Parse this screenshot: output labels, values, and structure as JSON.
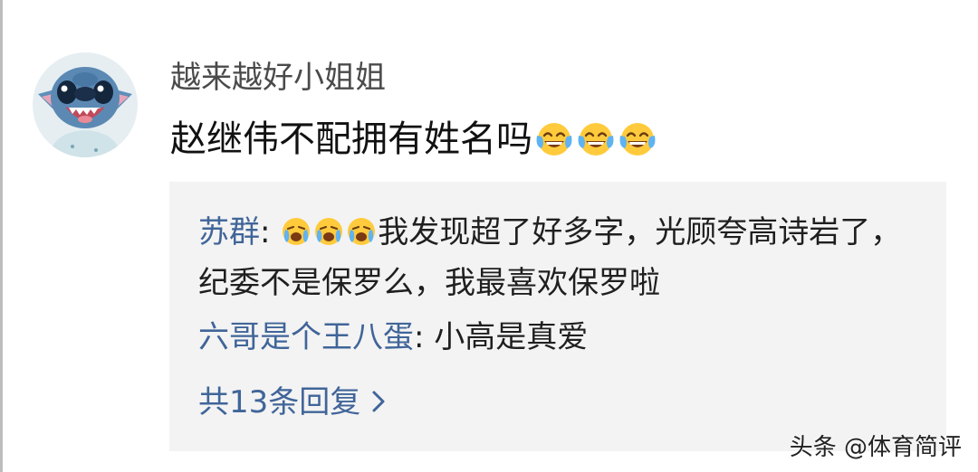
{
  "comment": {
    "avatar_icon": "stitch-avatar-icon",
    "username": "越来越好小姐姐",
    "text": "赵继伟不配拥有姓名吗",
    "emoji_icon": "laughing-crying-emoji-icon",
    "emoji_count": 3
  },
  "replies": [
    {
      "author": "苏群",
      "separator": ": ",
      "emoji_count": 3,
      "text": "我发现超了好多字，光顾夸高诗岩了，纪委不是保罗么，我最喜欢保罗啦"
    },
    {
      "author": "六哥是个王八蛋",
      "separator": ": ",
      "text": "小高是真爱"
    }
  ],
  "more_replies": {
    "label": "共13条回复",
    "icon": "chevron-right-icon"
  },
  "watermark": "头条 @体育简评",
  "colors": {
    "link_blue": "#406599",
    "reply_background": "#f3f3f3"
  }
}
